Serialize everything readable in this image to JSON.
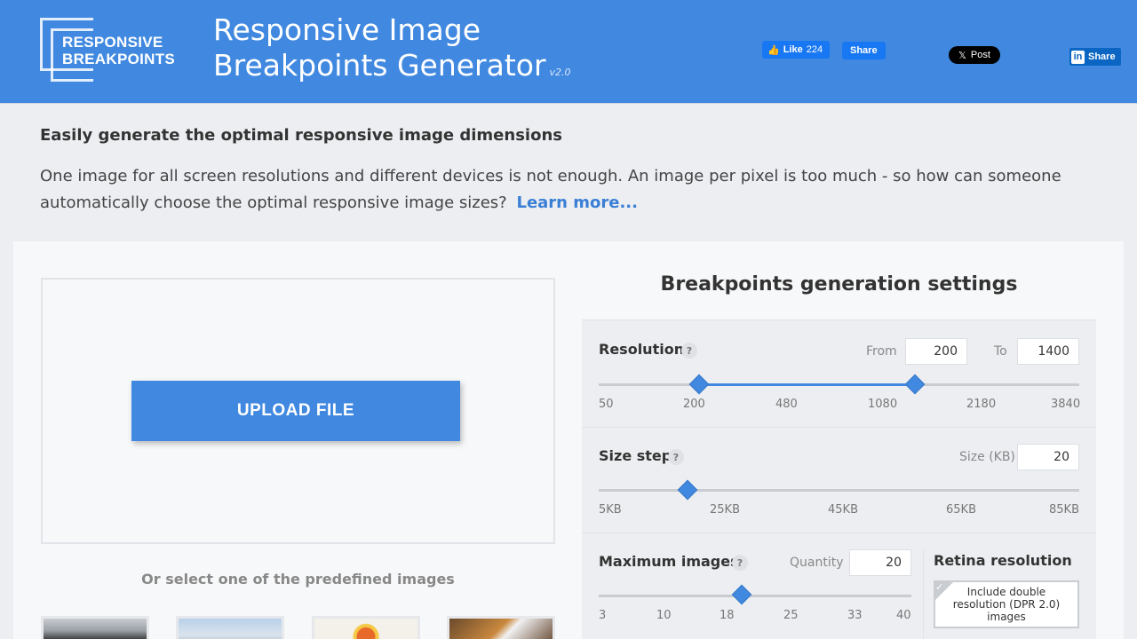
{
  "header": {
    "logo_line1": "RESPONSIVE",
    "logo_line2": "BREAKPOINTS",
    "title_line1": "Responsive Image",
    "title_line2": "Breakpoints Generator",
    "version": "v2.0",
    "fb_like_label": "Like",
    "fb_like_count": "224",
    "fb_share_label": "Share",
    "x_post_label": "Post",
    "linkedin_share_label": "Share",
    "brand_color": "#4189e0"
  },
  "intro": {
    "heading": "Easily generate the optimal responsive image dimensions",
    "text": "One image for all screen resolutions and different devices is not enough. An image per pixel is too much - so how can someone automatically choose the optimal responsive image sizes?",
    "learn_more": "Learn more..."
  },
  "upload": {
    "button_label": "UPLOAD FILE",
    "predefined_label": "Or select one of the predefined images"
  },
  "settings": {
    "title": "Breakpoints generation settings",
    "resolution": {
      "label": "Resolution",
      "help": "?",
      "from_label": "From",
      "from_value": "200",
      "to_label": "To",
      "to_value": "1400",
      "ticks": [
        "50",
        "200",
        "480",
        "1080",
        "2180",
        "3840"
      ]
    },
    "size_step": {
      "label": "Size step",
      "help": "?",
      "size_label": "Size (KB)",
      "size_value": "20",
      "ticks": [
        "5KB",
        "25KB",
        "45KB",
        "65KB",
        "85KB"
      ]
    },
    "max_images": {
      "label": "Maximum images",
      "help": "?",
      "quantity_label": "Quantity",
      "quantity_value": "20",
      "ticks": [
        "3",
        "10",
        "18",
        "25",
        "33",
        "40"
      ]
    },
    "retina": {
      "title": "Retina resolution",
      "option_label": "Include double resolution (DPR 2.0) images",
      "check_mark": "✓"
    }
  }
}
